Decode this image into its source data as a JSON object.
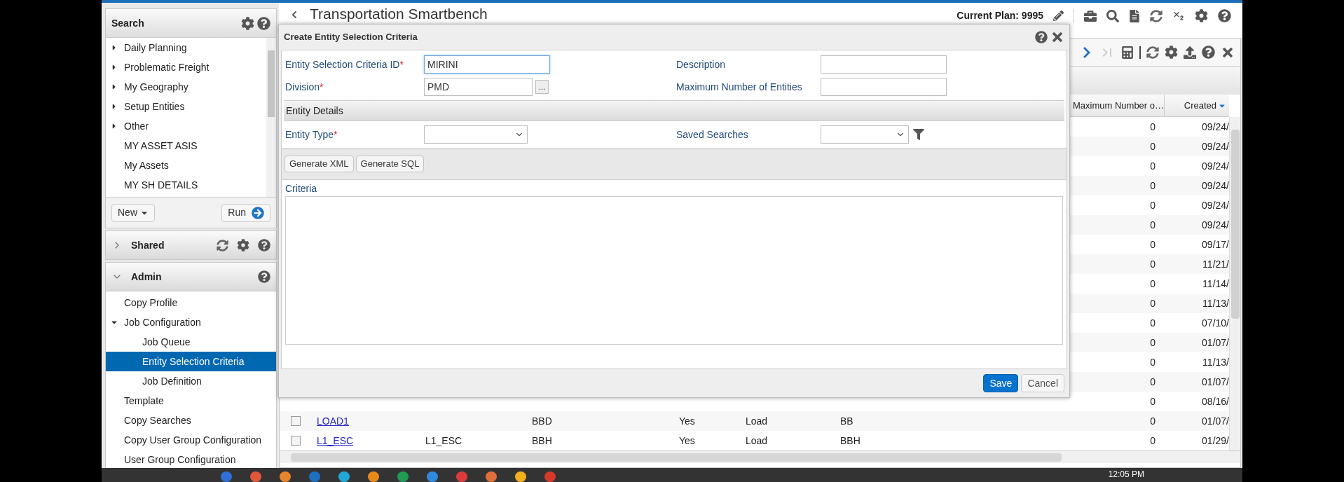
{
  "app_header": {
    "title": "Transportation Smartbench",
    "current_plan": "Current Plan: 9995"
  },
  "sidebar": {
    "search": {
      "title": "Search",
      "tree": [
        {
          "label": "Daily Planning",
          "kind": "folder",
          "expanded": false,
          "selected": false
        },
        {
          "label": "Problematic Freight",
          "kind": "folder",
          "expanded": false,
          "selected": false
        },
        {
          "label": "My Geography",
          "kind": "folder",
          "expanded": false,
          "selected": false
        },
        {
          "label": "Setup Entities",
          "kind": "folder",
          "expanded": false,
          "selected": false
        },
        {
          "label": "Other",
          "kind": "folder",
          "expanded": false,
          "selected": false
        },
        {
          "label": "MY ASSET ASIS",
          "kind": "leaf",
          "selected": false
        },
        {
          "label": "My Assets",
          "kind": "leaf",
          "selected": false
        },
        {
          "label": "MY SH DETAILS",
          "kind": "leaf",
          "selected": false
        }
      ],
      "new_button": "New",
      "run_button": "Run"
    },
    "panels": [
      {
        "title": "Shared",
        "kind": "shared",
        "expanded": false
      },
      {
        "title": "Admin",
        "kind": "admin",
        "expanded": true,
        "items": [
          {
            "label": "Copy Profile",
            "kind": "leaf",
            "selected": false
          },
          {
            "label": "Job Configuration",
            "kind": "folder",
            "expanded": true,
            "selected": false,
            "children": [
              {
                "label": "Job Queue",
                "kind": "leaf",
                "selected": false
              },
              {
                "label": "Entity Selection Criteria",
                "kind": "leaf",
                "selected": true
              },
              {
                "label": "Job Definition",
                "kind": "leaf",
                "selected": false
              }
            ]
          },
          {
            "label": "Template",
            "kind": "leaf",
            "selected": false
          },
          {
            "label": "Copy Searches",
            "kind": "leaf",
            "selected": false
          },
          {
            "label": "Copy User Group Configuration",
            "kind": "leaf",
            "selected": false
          },
          {
            "label": "User Group Configuration",
            "kind": "leaf",
            "selected": false
          }
        ]
      }
    ]
  },
  "grid": {
    "toolbar": [
      {
        "kind": "next",
        "disabled": false
      },
      {
        "kind": "last",
        "disabled": true
      },
      {
        "kind": "calculator"
      },
      {
        "kind": "refresh"
      },
      {
        "kind": "settings"
      },
      {
        "kind": "upload"
      },
      {
        "kind": "help"
      },
      {
        "kind": "close"
      }
    ],
    "columns": [
      {
        "label": "Maximum Number o…",
        "menu": false
      },
      {
        "label": "Created",
        "menu": true
      }
    ],
    "rows": [
      {
        "max": "0",
        "created": "09/24/"
      },
      {
        "max": "0",
        "created": "09/24/"
      },
      {
        "max": "0",
        "created": "09/24/"
      },
      {
        "max": "0",
        "created": "09/24/"
      },
      {
        "max": "0",
        "created": "09/24/"
      },
      {
        "max": "0",
        "created": "09/24/"
      },
      {
        "max": "0",
        "created": "09/17/"
      },
      {
        "max": "0",
        "created": "11/21/"
      },
      {
        "max": "0",
        "created": "11/14/"
      },
      {
        "max": "0",
        "created": "11/13/"
      },
      {
        "max": "0",
        "created": "07/10/"
      },
      {
        "max": "0",
        "created": "01/07/"
      },
      {
        "max": "0",
        "created": "11/13/"
      },
      {
        "max": "0",
        "created": "01/07/"
      },
      {
        "max": "0",
        "created": "08/16/"
      },
      {
        "checked": false,
        "name": "LOAD1",
        "column_4": "BBD",
        "column_5": "Yes",
        "column_6": "Load",
        "column_7": "BB",
        "max": "0",
        "created": "01/07/"
      },
      {
        "checked": false,
        "name": "L1_ESC",
        "column_3": "L1_ESC",
        "column_4": "BBH",
        "column_5": "Yes",
        "column_6": "Load",
        "column_7": "BBH",
        "max": "0",
        "created": "01/29/"
      }
    ]
  },
  "dialog": {
    "title": "Create Entity Selection Criteria",
    "required_mark": "*",
    "fields": [
      {
        "label": "Entity Selection Criteria ID",
        "kind": "text",
        "required": true,
        "value": "MIRINI",
        "focused": true
      },
      {
        "label": "Description",
        "kind": "text",
        "required": false,
        "focused": false
      },
      {
        "label": "Division",
        "kind": "lookup",
        "required": true,
        "value": "PMD",
        "focused": false,
        "lookup_button": "..."
      },
      {
        "label": "Maximum Number of Entities",
        "kind": "text",
        "required": false,
        "focused": false
      }
    ],
    "section_title": "Entity Details",
    "detail_fields": [
      {
        "label": "Entity Type",
        "kind": "select",
        "required": true,
        "filter": false
      },
      {
        "label": "Saved Searches",
        "kind": "select",
        "required": false,
        "filter": true
      }
    ],
    "actions": [
      "Generate XML",
      "Generate SQL"
    ],
    "criteria_label": "Criteria",
    "save_button": "Save",
    "cancel_button": "Cancel"
  },
  "taskbar": {
    "clock": "12:05 PM"
  }
}
